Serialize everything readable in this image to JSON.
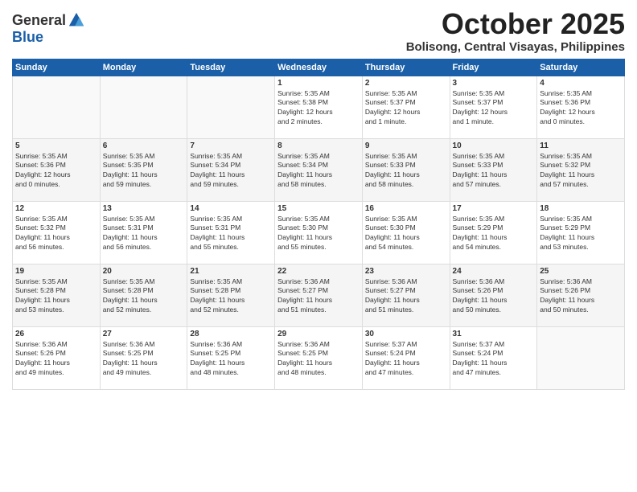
{
  "header": {
    "logo_line1": "General",
    "logo_line2": "Blue",
    "month": "October 2025",
    "location": "Bolisong, Central Visayas, Philippines"
  },
  "days_of_week": [
    "Sunday",
    "Monday",
    "Tuesday",
    "Wednesday",
    "Thursday",
    "Friday",
    "Saturday"
  ],
  "weeks": [
    [
      {
        "day": "",
        "lines": []
      },
      {
        "day": "",
        "lines": []
      },
      {
        "day": "",
        "lines": []
      },
      {
        "day": "1",
        "lines": [
          "Sunrise: 5:35 AM",
          "Sunset: 5:38 PM",
          "Daylight: 12 hours",
          "and 2 minutes."
        ]
      },
      {
        "day": "2",
        "lines": [
          "Sunrise: 5:35 AM",
          "Sunset: 5:37 PM",
          "Daylight: 12 hours",
          "and 1 minute."
        ]
      },
      {
        "day": "3",
        "lines": [
          "Sunrise: 5:35 AM",
          "Sunset: 5:37 PM",
          "Daylight: 12 hours",
          "and 1 minute."
        ]
      },
      {
        "day": "4",
        "lines": [
          "Sunrise: 5:35 AM",
          "Sunset: 5:36 PM",
          "Daylight: 12 hours",
          "and 0 minutes."
        ]
      }
    ],
    [
      {
        "day": "5",
        "lines": [
          "Sunrise: 5:35 AM",
          "Sunset: 5:36 PM",
          "Daylight: 12 hours",
          "and 0 minutes."
        ]
      },
      {
        "day": "6",
        "lines": [
          "Sunrise: 5:35 AM",
          "Sunset: 5:35 PM",
          "Daylight: 11 hours",
          "and 59 minutes."
        ]
      },
      {
        "day": "7",
        "lines": [
          "Sunrise: 5:35 AM",
          "Sunset: 5:34 PM",
          "Daylight: 11 hours",
          "and 59 minutes."
        ]
      },
      {
        "day": "8",
        "lines": [
          "Sunrise: 5:35 AM",
          "Sunset: 5:34 PM",
          "Daylight: 11 hours",
          "and 58 minutes."
        ]
      },
      {
        "day": "9",
        "lines": [
          "Sunrise: 5:35 AM",
          "Sunset: 5:33 PM",
          "Daylight: 11 hours",
          "and 58 minutes."
        ]
      },
      {
        "day": "10",
        "lines": [
          "Sunrise: 5:35 AM",
          "Sunset: 5:33 PM",
          "Daylight: 11 hours",
          "and 57 minutes."
        ]
      },
      {
        "day": "11",
        "lines": [
          "Sunrise: 5:35 AM",
          "Sunset: 5:32 PM",
          "Daylight: 11 hours",
          "and 57 minutes."
        ]
      }
    ],
    [
      {
        "day": "12",
        "lines": [
          "Sunrise: 5:35 AM",
          "Sunset: 5:32 PM",
          "Daylight: 11 hours",
          "and 56 minutes."
        ]
      },
      {
        "day": "13",
        "lines": [
          "Sunrise: 5:35 AM",
          "Sunset: 5:31 PM",
          "Daylight: 11 hours",
          "and 56 minutes."
        ]
      },
      {
        "day": "14",
        "lines": [
          "Sunrise: 5:35 AM",
          "Sunset: 5:31 PM",
          "Daylight: 11 hours",
          "and 55 minutes."
        ]
      },
      {
        "day": "15",
        "lines": [
          "Sunrise: 5:35 AM",
          "Sunset: 5:30 PM",
          "Daylight: 11 hours",
          "and 55 minutes."
        ]
      },
      {
        "day": "16",
        "lines": [
          "Sunrise: 5:35 AM",
          "Sunset: 5:30 PM",
          "Daylight: 11 hours",
          "and 54 minutes."
        ]
      },
      {
        "day": "17",
        "lines": [
          "Sunrise: 5:35 AM",
          "Sunset: 5:29 PM",
          "Daylight: 11 hours",
          "and 54 minutes."
        ]
      },
      {
        "day": "18",
        "lines": [
          "Sunrise: 5:35 AM",
          "Sunset: 5:29 PM",
          "Daylight: 11 hours",
          "and 53 minutes."
        ]
      }
    ],
    [
      {
        "day": "19",
        "lines": [
          "Sunrise: 5:35 AM",
          "Sunset: 5:28 PM",
          "Daylight: 11 hours",
          "and 53 minutes."
        ]
      },
      {
        "day": "20",
        "lines": [
          "Sunrise: 5:35 AM",
          "Sunset: 5:28 PM",
          "Daylight: 11 hours",
          "and 52 minutes."
        ]
      },
      {
        "day": "21",
        "lines": [
          "Sunrise: 5:35 AM",
          "Sunset: 5:28 PM",
          "Daylight: 11 hours",
          "and 52 minutes."
        ]
      },
      {
        "day": "22",
        "lines": [
          "Sunrise: 5:36 AM",
          "Sunset: 5:27 PM",
          "Daylight: 11 hours",
          "and 51 minutes."
        ]
      },
      {
        "day": "23",
        "lines": [
          "Sunrise: 5:36 AM",
          "Sunset: 5:27 PM",
          "Daylight: 11 hours",
          "and 51 minutes."
        ]
      },
      {
        "day": "24",
        "lines": [
          "Sunrise: 5:36 AM",
          "Sunset: 5:26 PM",
          "Daylight: 11 hours",
          "and 50 minutes."
        ]
      },
      {
        "day": "25",
        "lines": [
          "Sunrise: 5:36 AM",
          "Sunset: 5:26 PM",
          "Daylight: 11 hours",
          "and 50 minutes."
        ]
      }
    ],
    [
      {
        "day": "26",
        "lines": [
          "Sunrise: 5:36 AM",
          "Sunset: 5:26 PM",
          "Daylight: 11 hours",
          "and 49 minutes."
        ]
      },
      {
        "day": "27",
        "lines": [
          "Sunrise: 5:36 AM",
          "Sunset: 5:25 PM",
          "Daylight: 11 hours",
          "and 49 minutes."
        ]
      },
      {
        "day": "28",
        "lines": [
          "Sunrise: 5:36 AM",
          "Sunset: 5:25 PM",
          "Daylight: 11 hours",
          "and 48 minutes."
        ]
      },
      {
        "day": "29",
        "lines": [
          "Sunrise: 5:36 AM",
          "Sunset: 5:25 PM",
          "Daylight: 11 hours",
          "and 48 minutes."
        ]
      },
      {
        "day": "30",
        "lines": [
          "Sunrise: 5:37 AM",
          "Sunset: 5:24 PM",
          "Daylight: 11 hours",
          "and 47 minutes."
        ]
      },
      {
        "day": "31",
        "lines": [
          "Sunrise: 5:37 AM",
          "Sunset: 5:24 PM",
          "Daylight: 11 hours",
          "and 47 minutes."
        ]
      },
      {
        "day": "",
        "lines": []
      }
    ]
  ]
}
